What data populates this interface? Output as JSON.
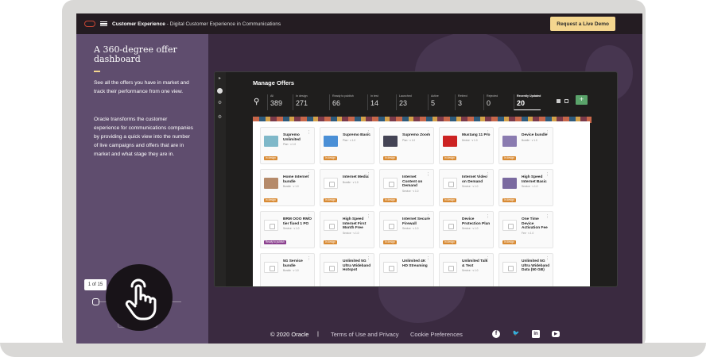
{
  "nav": {
    "brand_bold": "Customer Experience",
    "brand_sub": " - Digital Customer Experience in Communications",
    "demo_button": "Request a Live Demo"
  },
  "left_panel": {
    "title": "A 360-degree offer dashboard",
    "paragraph1": "See all the offers you have in market and track their performance from one view.",
    "paragraph2": "Oracle transforms the customer experience for communications companies by providing a quick view into the number of live campaigns and offers that are in market and what stage they are in.",
    "counter": "1 of 15",
    "prev_arrow": "←",
    "next_arrow": "→"
  },
  "app": {
    "title": "Manage Offers",
    "stats": [
      {
        "label": "All",
        "value": "389"
      },
      {
        "label": "In design",
        "value": "271"
      },
      {
        "label": "Ready to publish",
        "value": "66"
      },
      {
        "label": "In test",
        "value": "14"
      },
      {
        "label": "Launched",
        "value": "23"
      },
      {
        "label": "Active",
        "value": "5"
      },
      {
        "label": "Retired",
        "value": "3"
      },
      {
        "label": "Rejected",
        "value": "0"
      },
      {
        "label": "Recently Updated",
        "value": "20"
      }
    ],
    "add_label": "+",
    "cards": [
      {
        "name": "Supremo Unlimited",
        "meta": "Plan · v 1.0",
        "badge": "In design",
        "thumb": "#7fb8c9"
      },
      {
        "name": "Supremo Basic",
        "meta": "Plan · v 1.0",
        "badge": "In design",
        "thumb": "#4a8fd6"
      },
      {
        "name": "Supremo Zoom",
        "meta": "Plan · v 1.0",
        "badge": "In design",
        "thumb": "#445"
      },
      {
        "name": "Mustang 11 Pro",
        "meta": "Device · v 1.0",
        "badge": "In design",
        "thumb": "#c22"
      },
      {
        "name": "Device bundle",
        "meta": "Bundle · v 1.0",
        "badge": "In design",
        "thumb": "#8a7bb0"
      },
      {
        "name": "Home Internet bundle",
        "meta": "Bundle · v 1.0",
        "badge": "In design",
        "thumb": "#b58a6a"
      },
      {
        "name": "Internet Media",
        "meta": "Bundle · v 1.0",
        "badge": "In design",
        "thumb": ""
      },
      {
        "name": "Internet Content on Demand",
        "meta": "Service · v 1.0",
        "badge": "In design",
        "thumb": ""
      },
      {
        "name": "Internet Video on Demand",
        "meta": "Service · v 1.0",
        "badge": "In design",
        "thumb": ""
      },
      {
        "name": "High Speed Internet Basic",
        "meta": "Service · v 1.0",
        "badge": "In design",
        "thumb": "#7a6aa0"
      },
      {
        "name": "BRM OOO RMO tier fixed 1 PO",
        "meta": "Service · v 1.0",
        "badge": "Ready to publish",
        "thumb": ""
      },
      {
        "name": "High Speed Internet First Month Free",
        "meta": "Service · v 1.0",
        "badge": "In design",
        "thumb": ""
      },
      {
        "name": "Internet Secure Firewall",
        "meta": "Service · v 1.0",
        "badge": "In design",
        "thumb": ""
      },
      {
        "name": "Device Protection Plan",
        "meta": "Service · v 1.0",
        "badge": "In design",
        "thumb": ""
      },
      {
        "name": "One Time Device Activation Fee",
        "meta": "Fee · v 1.0",
        "badge": "In design",
        "thumb": ""
      },
      {
        "name": "5G Service bundle",
        "meta": "Bundle · v 1.0",
        "badge": "",
        "thumb": ""
      },
      {
        "name": "Unlimited 5G Ultra Wideband Hotspot",
        "meta": "",
        "badge": "",
        "thumb": ""
      },
      {
        "name": "Unlimited 4K HD Streaming",
        "meta": "",
        "badge": "",
        "thumb": ""
      },
      {
        "name": "Unlimited Talk & Text",
        "meta": "Service · v 1.0",
        "badge": "",
        "thumb": ""
      },
      {
        "name": "Unlimited 5G Ultra Wideband Data (50 GB)",
        "meta": "",
        "badge": "",
        "thumb": ""
      }
    ]
  },
  "footer": {
    "copyright": "© 2020 Oracle",
    "separator": "|",
    "terms": "Terms of Use and Privacy",
    "cookie": "Cookie Preferences",
    "social_fb": "f",
    "social_tw": "🐦",
    "social_li": "in",
    "social_yt": "▶"
  }
}
